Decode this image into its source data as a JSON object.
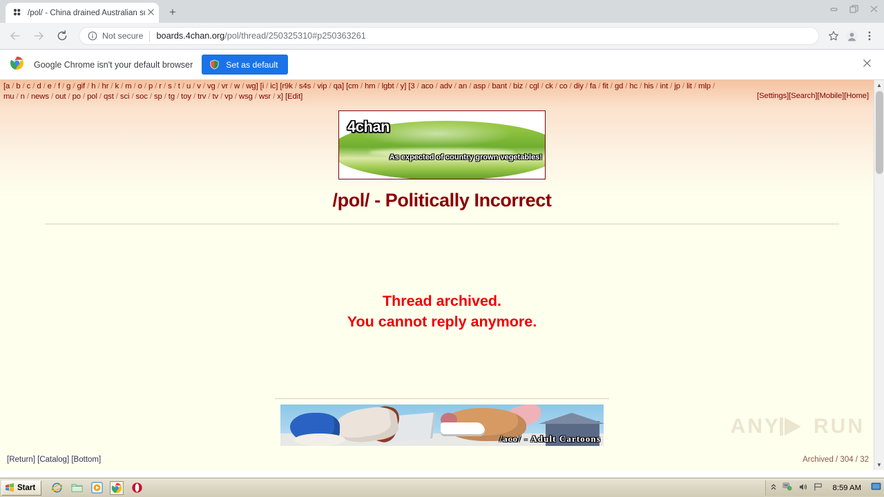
{
  "browser": {
    "tab": {
      "title": "/pol/ - China drained Australian supp",
      "favicon_icon": "fourchan-favicon-icon",
      "close_icon": "close-icon"
    },
    "newtab_label": "+",
    "window_controls": {
      "minimize": "minimize-icon",
      "restore": "restore-icon",
      "close": "close-icon"
    },
    "toolbar": {
      "back_icon": "back-arrow-icon",
      "forward_icon": "forward-arrow-icon",
      "reload_icon": "reload-icon",
      "security_label": "Not secure",
      "url_host": "boards.4chan.org",
      "url_path": "/pol/thread/250325310#p250363261",
      "bookmark_icon": "star-icon",
      "profile_icon": "avatar-icon",
      "menu_icon": "three-dots-menu-icon"
    },
    "infobar": {
      "chrome_icon": "chrome-logo-icon",
      "message": "Google Chrome isn't your default browser",
      "button_label": "Set as default",
      "button_icon": "shield-icon",
      "close_icon": "close-icon",
      "accent": "#1a73e8"
    }
  },
  "page": {
    "board_groups": [
      {
        "open": "[",
        "boards": [
          "a",
          "b",
          "c",
          "d",
          "e",
          "f",
          "g",
          "gif",
          "h",
          "hr",
          "k",
          "m",
          "o",
          "p",
          "r",
          "s",
          "t",
          "u",
          "v",
          "vg",
          "vr",
          "w",
          "wg"
        ],
        "close": "]"
      },
      {
        "open": "[",
        "boards": [
          "i",
          "ic"
        ],
        "close": "]"
      },
      {
        "open": "[",
        "boards": [
          "r9k",
          "s4s",
          "vip",
          "qa"
        ],
        "close": "]"
      },
      {
        "open": "[",
        "boards": [
          "cm",
          "hm",
          "lgbt",
          "y"
        ],
        "close": "]"
      },
      {
        "open": "[",
        "boards": [
          "3",
          "aco",
          "adv",
          "an",
          "asp",
          "bant",
          "biz",
          "cgl",
          "ck",
          "co",
          "diy",
          "fa",
          "fit",
          "gd",
          "hc",
          "his",
          "int",
          "jp",
          "lit",
          "mlp",
          "mu",
          "n",
          "news",
          "out",
          "po",
          "pol",
          "qst",
          "sci",
          "soc",
          "sp",
          "tg",
          "toy",
          "trv",
          "tv",
          "vp",
          "wsg",
          "wsr",
          "x"
        ],
        "close": "]"
      }
    ],
    "edit_link": "[Edit]",
    "corner_links": [
      "[Settings]",
      "[Search]",
      "[Mobile]",
      "[Home]"
    ],
    "banner": {
      "logo_text": "4chan",
      "caption": "As expected of country grown vegetables!",
      "alt_name": "cucumber-banner-image"
    },
    "board_title": "/pol/ - Politically Incorrect",
    "archived_line1": "Thread archived.",
    "archived_line2": "You cannot reply anymore.",
    "archived_color": "#f00000",
    "ad_banner": {
      "text": "/aco/ - Adult Cartoons",
      "alt_name": "aco-ad-banner-image"
    },
    "footer_links": [
      "[Return]",
      "[Catalog]",
      "[Bottom]"
    ],
    "footer_status": "Archived / 304 / 32",
    "watermark": {
      "left": "ANY",
      "right": "RUN"
    }
  },
  "taskbar": {
    "start_label": "Start",
    "quick_launch": [
      {
        "name": "internet-explorer-icon"
      },
      {
        "name": "file-explorer-icon"
      },
      {
        "name": "media-player-icon"
      },
      {
        "name": "chrome-icon",
        "active": true
      },
      {
        "name": "opera-icon"
      }
    ],
    "tray": {
      "chevron_icon": "show-hidden-icons-icon",
      "network_icon": "network-icon",
      "volume_icon": "volume-icon",
      "flag_icon": "language-flag-icon",
      "time": "8:59 AM",
      "display_icon": "display-icon"
    }
  }
}
